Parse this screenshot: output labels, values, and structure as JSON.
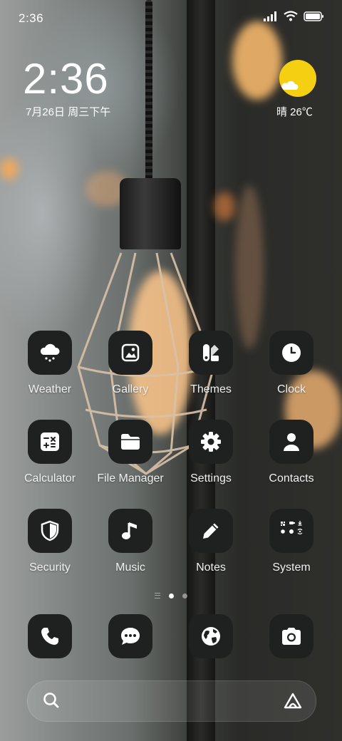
{
  "status_bar": {
    "time": "2:36",
    "icons": [
      "signal-icon",
      "wifi-icon",
      "battery-icon"
    ]
  },
  "clock_widget": {
    "time": "2:36",
    "date": "7月26日 周三下午",
    "weather": "晴 26℃",
    "weather_icon": "sun-cloud-icon",
    "sun_color": "#f5cf12"
  },
  "apps": [
    {
      "label": "Weather",
      "icon": "weather-cloud-icon"
    },
    {
      "label": "Gallery",
      "icon": "gallery-icon"
    },
    {
      "label": "Themes",
      "icon": "themes-icon"
    },
    {
      "label": "Clock",
      "icon": "clock-icon"
    },
    {
      "label": "Calculator",
      "icon": "calculator-icon"
    },
    {
      "label": "File Manager",
      "icon": "folder-icon"
    },
    {
      "label": "Settings",
      "icon": "gear-icon"
    },
    {
      "label": "Contacts",
      "icon": "contact-icon"
    },
    {
      "label": "Security",
      "icon": "shield-icon"
    },
    {
      "label": "Music",
      "icon": "music-note-icon"
    },
    {
      "label": "Notes",
      "icon": "pencil-icon"
    },
    {
      "label": "System",
      "icon": "system-folder-icon"
    }
  ],
  "page_indicator": {
    "pages": 2,
    "current": 1
  },
  "dock": [
    {
      "name": "Phone",
      "icon": "phone-icon"
    },
    {
      "name": "Messages",
      "icon": "message-icon"
    },
    {
      "name": "Browser",
      "icon": "globe-icon"
    },
    {
      "name": "Camera",
      "icon": "camera-icon"
    }
  ],
  "search_bar": {
    "icon": "search-icon",
    "assistant_icon": "assistant-icon"
  },
  "colors": {
    "icon_bg": "#1f2020",
    "accent_sun": "#f5cf12"
  }
}
